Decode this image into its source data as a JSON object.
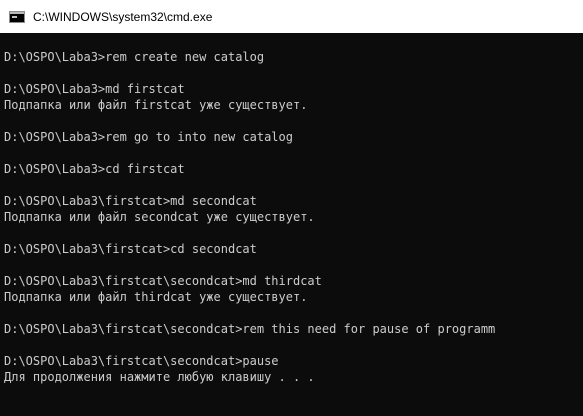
{
  "window": {
    "title": "C:\\WINDOWS\\system32\\cmd.exe",
    "icon": "console-icon"
  },
  "console": {
    "lines": [
      "",
      "D:\\OSPO\\Laba3>rem create new catalog",
      "",
      "D:\\OSPO\\Laba3>md firstcat",
      "Подпапка или файл firstcat уже существует.",
      "",
      "D:\\OSPO\\Laba3>rem go to into new catalog",
      "",
      "D:\\OSPO\\Laba3>cd firstcat",
      "",
      "D:\\OSPO\\Laba3\\firstcat>md secondcat",
      "Подпапка или файл secondcat уже существует.",
      "",
      "D:\\OSPO\\Laba3\\firstcat>cd secondcat",
      "",
      "D:\\OSPO\\Laba3\\firstcat\\secondcat>md thirdcat",
      "Подпапка или файл thirdcat уже существует.",
      "",
      "D:\\OSPO\\Laba3\\firstcat\\secondcat>rem this need for pause of programm",
      "",
      "D:\\OSPO\\Laba3\\firstcat\\secondcat>pause",
      "Для продолжения нажмите любую клавишу . . ."
    ]
  }
}
